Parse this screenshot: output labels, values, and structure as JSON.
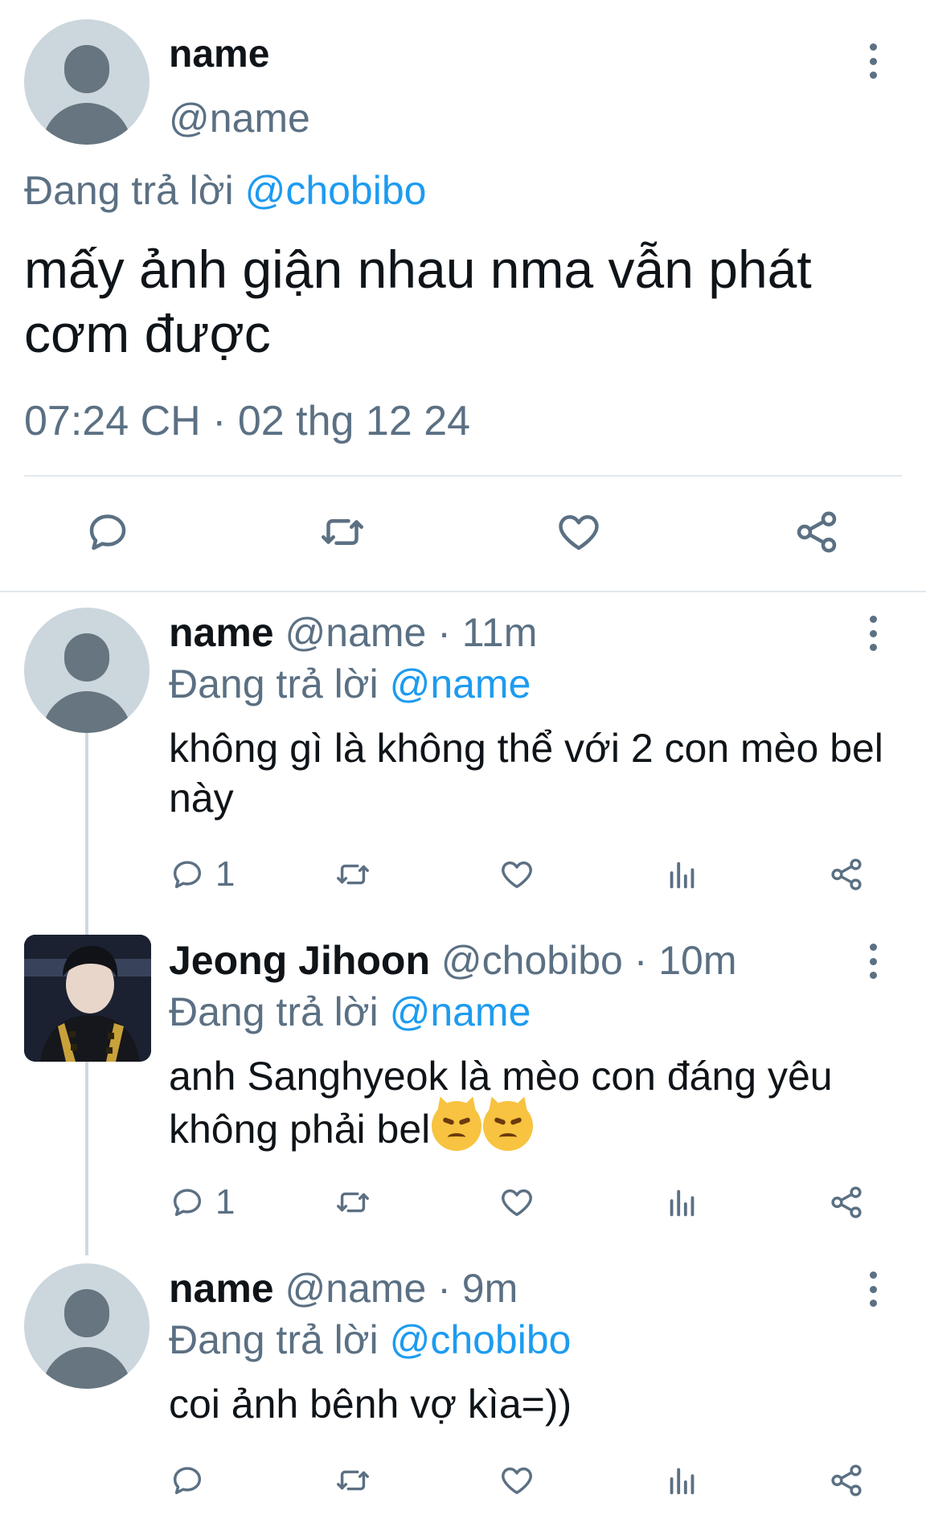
{
  "main_tweet": {
    "name": "name",
    "handle": "@name",
    "replying_prefix": "Đang trả lời ",
    "replying_to": "@chobibo",
    "text": "mấy ảnh giận nhau nma vẫn phát cơm được",
    "timestamp": "07:24 CH · 02 thg 12 24",
    "actions": [
      "reply-icon",
      "retweet-icon",
      "like-icon",
      "share-icon"
    ]
  },
  "replies": [
    {
      "name": "name",
      "meta": "@name · 11m",
      "replying_prefix": "Đang trả lời ",
      "replying_to": "@name",
      "text": "không gì là không thể với 2 con mèo bel này",
      "reply_count": "1"
    },
    {
      "name": "Jeong Jihoon",
      "meta": "@chobibo · 10m",
      "replying_prefix": "Đang trả lời ",
      "replying_to": "@name",
      "text": "anh Sanghyeok là mèo con đáng yêu không phải bel",
      "emoji": [
        "😾",
        "😾"
      ],
      "reply_count": "1"
    },
    {
      "name": "name",
      "meta": "@name · 9m",
      "replying_prefix": "Đang trả lời ",
      "replying_to": "@chobibo",
      "text": "coi ảnh bênh vợ kìa=))",
      "reply_count": ""
    }
  ],
  "colors": {
    "link": "#1d9bf0",
    "secondary_text": "#5b7083",
    "primary_text": "#0f1419",
    "divider": "#e1e8ed",
    "avatar_bg": "#ccd6dd",
    "thread_line": "#cfd9de"
  }
}
